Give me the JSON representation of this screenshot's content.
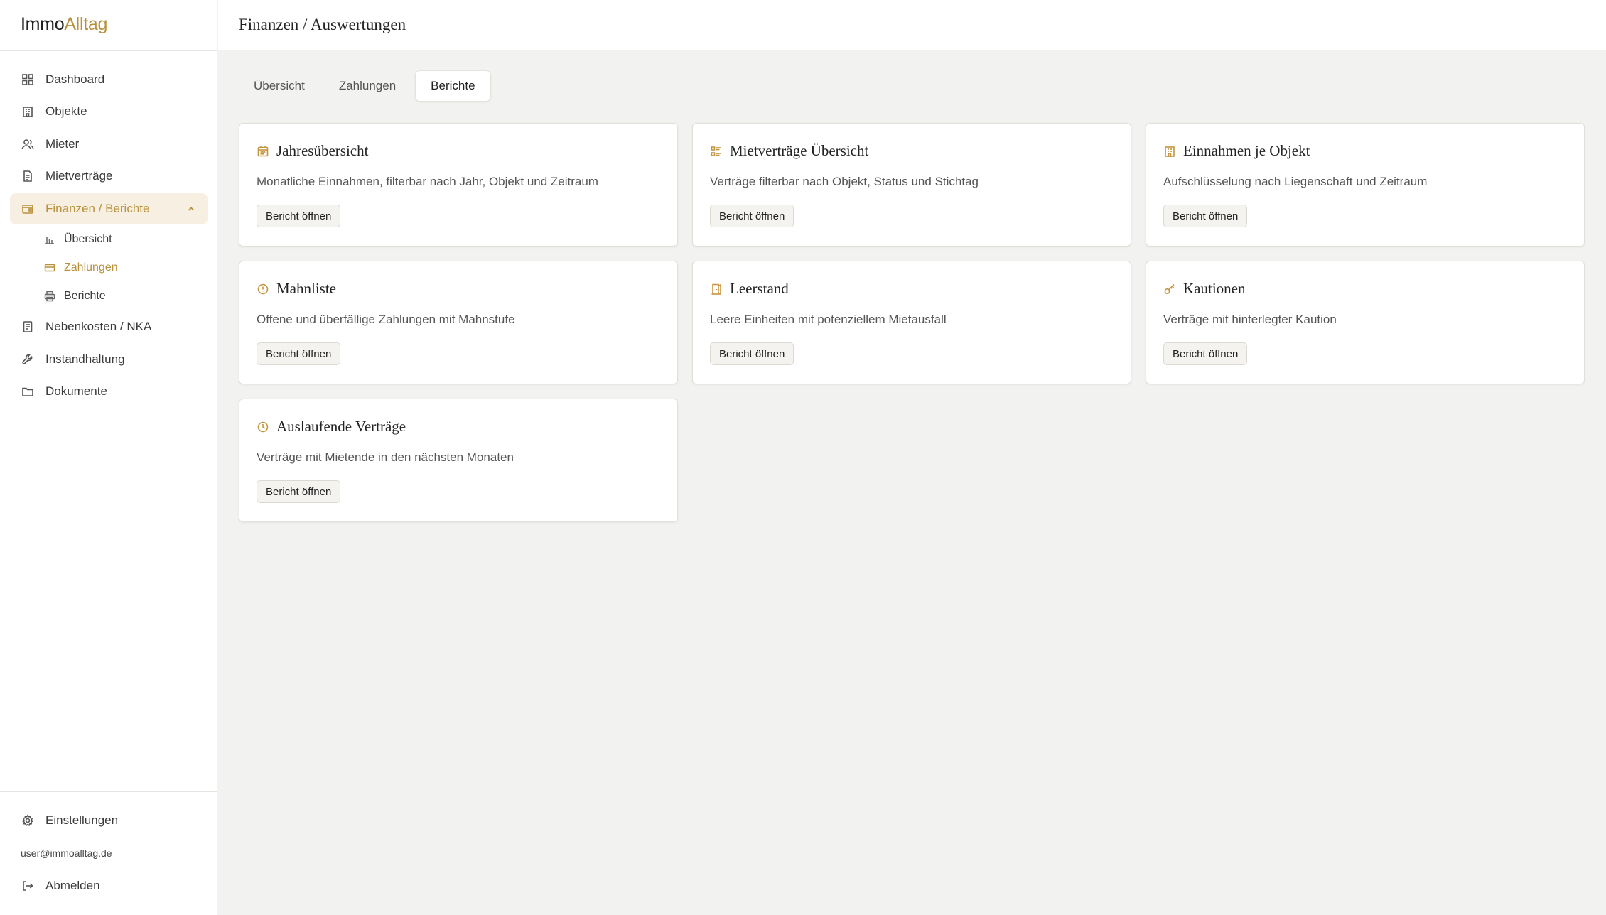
{
  "app": {
    "logo_primary": "Immo",
    "logo_accent": "Alltag",
    "accent_color": "#b8913c"
  },
  "sidebar": {
    "items": [
      {
        "label": "Dashboard",
        "icon": "dashboard-icon"
      },
      {
        "label": "Objekte",
        "icon": "building-icon"
      },
      {
        "label": "Mieter",
        "icon": "users-icon"
      },
      {
        "label": "Mietverträge",
        "icon": "document-icon"
      },
      {
        "label": "Finanzen / Berichte",
        "icon": "wallet-icon",
        "active": true
      },
      {
        "label": "Nebenkosten / NKA",
        "icon": "receipt-icon"
      },
      {
        "label": "Instandhaltung",
        "icon": "wrench-icon"
      },
      {
        "label": "Dokumente",
        "icon": "folder-icon"
      }
    ],
    "sub_items": [
      {
        "label": "Übersicht",
        "icon": "bar-chart-icon"
      },
      {
        "label": "Zahlungen",
        "icon": "credit-card-icon",
        "active": true
      },
      {
        "label": "Berichte",
        "icon": "printer-icon"
      }
    ],
    "settings_label": "Einstellungen",
    "user_email": "user@immoalltag.de",
    "logout_label": "Abmelden"
  },
  "header": {
    "title": "Finanzen / Auswertungen"
  },
  "tabs": [
    {
      "label": "Übersicht"
    },
    {
      "label": "Zahlungen"
    },
    {
      "label": "Berichte",
      "active": true
    }
  ],
  "reports": [
    {
      "title": "Jahresübersicht",
      "description": "Monatliche Einnahmen, filterbar nach Jahr, Objekt und Zeitraum",
      "button": "Bericht öffnen",
      "icon": "calendar-icon"
    },
    {
      "title": "Mietverträge Übersicht",
      "description": "Verträge filterbar nach Objekt, Status und Stichtag",
      "button": "Bericht öffnen",
      "icon": "list-icon"
    },
    {
      "title": "Einnahmen je Objekt",
      "description": "Aufschlüsselung nach Liegenschaft und Zeitraum",
      "button": "Bericht öffnen",
      "icon": "building-icon"
    },
    {
      "title": "Mahnliste",
      "description": "Offene und überfällige Zahlungen mit Mahnstufe",
      "button": "Bericht öffnen",
      "icon": "alert-circle-icon"
    },
    {
      "title": "Leerstand",
      "description": "Leere Einheiten mit potenziellem Mietausfall",
      "button": "Bericht öffnen",
      "icon": "door-icon"
    },
    {
      "title": "Kautionen",
      "description": "Verträge mit hinterlegter Kaution",
      "button": "Bericht öffnen",
      "icon": "key-icon"
    },
    {
      "title": "Auslaufende Verträge",
      "description": "Verträge mit Mietende in den nächsten Monaten",
      "button": "Bericht öffnen",
      "icon": "clock-icon"
    }
  ]
}
